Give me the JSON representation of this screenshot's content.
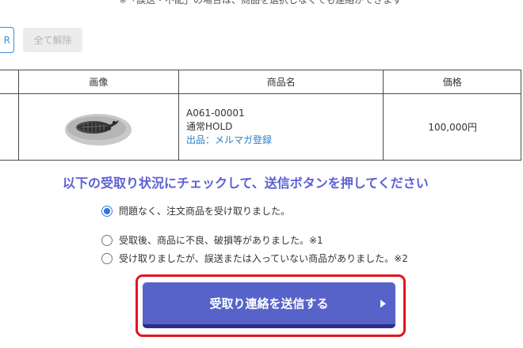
{
  "top_note": "※「誤送・不配」の場合は、商品を選択しなくても連絡ができます",
  "buttons": {
    "select_all_partial": "R",
    "clear_all": "全て解除"
  },
  "table": {
    "headers": [
      "",
      "画像",
      "商品名",
      "価格"
    ],
    "rows": [
      {
        "image_icon": "trilobite-fossil-photo",
        "code": "A061-00001",
        "status": "通常HOLD",
        "listing_link": "出品：メルマガ登録",
        "price": "100,000円"
      }
    ]
  },
  "instruction": "以下の受取り状況にチェックして、送信ボタンを押してください",
  "options": [
    {
      "label": "問題なく、注文商品を受け取りました。",
      "checked": true
    },
    {
      "label": "受取後、商品に不良、破損等がありました。※1",
      "checked": false
    },
    {
      "label": "受け取りましたが、誤送または入っていない商品がありました。※2",
      "checked": false
    }
  ],
  "submit": {
    "label": "受取り連絡を送信する",
    "arrow_icon": "triangle-right-icon"
  },
  "colors": {
    "accent": "#5763c8",
    "instruction": "#5b5fd3",
    "highlight_frame": "#e4141e",
    "link": "#2a7fc8"
  }
}
